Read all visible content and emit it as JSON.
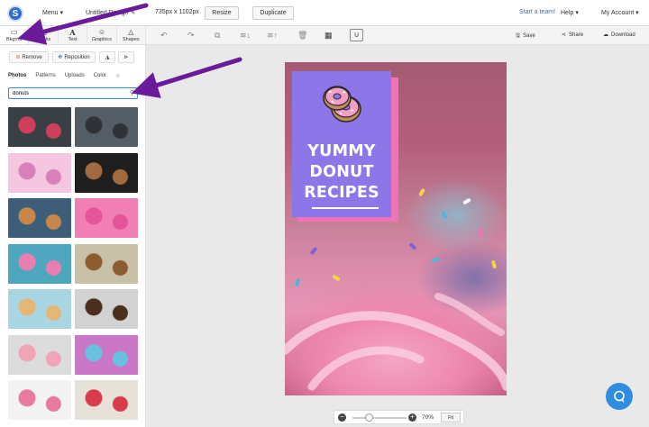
{
  "app": {
    "logo_letter": "S"
  },
  "topbar": {
    "menu_label": "Menu",
    "doc_title": "Untitled Design",
    "dimensions": "735px x 1102px",
    "resize_label": "Resize",
    "duplicate_label": "Duplicate",
    "start_team_label": "Start a team!",
    "help_label": "Help",
    "account_label": "My Account"
  },
  "tool_tabs": [
    {
      "label": "Bkgrnd",
      "icon": "background-icon"
    },
    {
      "label": "Blocks",
      "icon": "blocks-icon"
    },
    {
      "label": "Text",
      "icon": "text-icon"
    },
    {
      "label": "Graphics",
      "icon": "graphics-icon"
    },
    {
      "label": "Shapes",
      "icon": "shapes-icon"
    }
  ],
  "editor_toolbar": {
    "save_label": "Save",
    "share_label": "Share",
    "download_label": "Download"
  },
  "panel": {
    "remove_label": "Remove",
    "reposition_label": "Reposition",
    "subtabs": [
      "Photos",
      "Patterns",
      "Uploads",
      "Color"
    ],
    "search_value": "donuts",
    "thumbnails": [
      {
        "name": "thumb-donuts-dark-table",
        "colors": [
          "#3a3f46",
          "#cf3f5b"
        ]
      },
      {
        "name": "thumb-donut-grey",
        "colors": [
          "#555d66",
          "#2f3337"
        ]
      },
      {
        "name": "thumb-donut-drinks",
        "colors": [
          "#f4c6e0",
          "#d97fb9"
        ]
      },
      {
        "name": "thumb-donuts-chocolate",
        "colors": [
          "#1e1e1e",
          "#a26b3f"
        ]
      },
      {
        "name": "thumb-donut-shop",
        "colors": [
          "#3e5d79",
          "#c7874b"
        ]
      },
      {
        "name": "thumb-donuts-pink",
        "colors": [
          "#f27fb4",
          "#e5539a"
        ]
      },
      {
        "name": "thumb-donuts-teal",
        "colors": [
          "#4fa6bf",
          "#e97fb1"
        ]
      },
      {
        "name": "thumb-donuts-assorted",
        "colors": [
          "#c9c0a8",
          "#8c5b2e"
        ]
      },
      {
        "name": "thumb-donuts-plate",
        "colors": [
          "#a9d6e2",
          "#e4b774"
        ]
      },
      {
        "name": "thumb-donut-stack",
        "colors": [
          "#d2d2d2",
          "#4a2f1e"
        ]
      },
      {
        "name": "thumb-donut-hand",
        "colors": [
          "#dcdcdc",
          "#f1a3b8"
        ]
      },
      {
        "name": "thumb-sprinkles",
        "colors": [
          "#c977c6",
          "#67c2e2"
        ]
      },
      {
        "name": "thumb-donut-white",
        "colors": [
          "#f3f3f3",
          "#e67aa1"
        ]
      },
      {
        "name": "thumb-donuts-colorful",
        "colors": [
          "#e7e2d9",
          "#d73c4a"
        ]
      }
    ]
  },
  "canvas": {
    "title_lines": [
      "YUMMY",
      "DONUT",
      "RECIPES"
    ],
    "card_color": "#8d76e8",
    "card_shadow_color": "#ee73b7"
  },
  "zoom": {
    "level": "70%",
    "fit_label": "Fit"
  }
}
